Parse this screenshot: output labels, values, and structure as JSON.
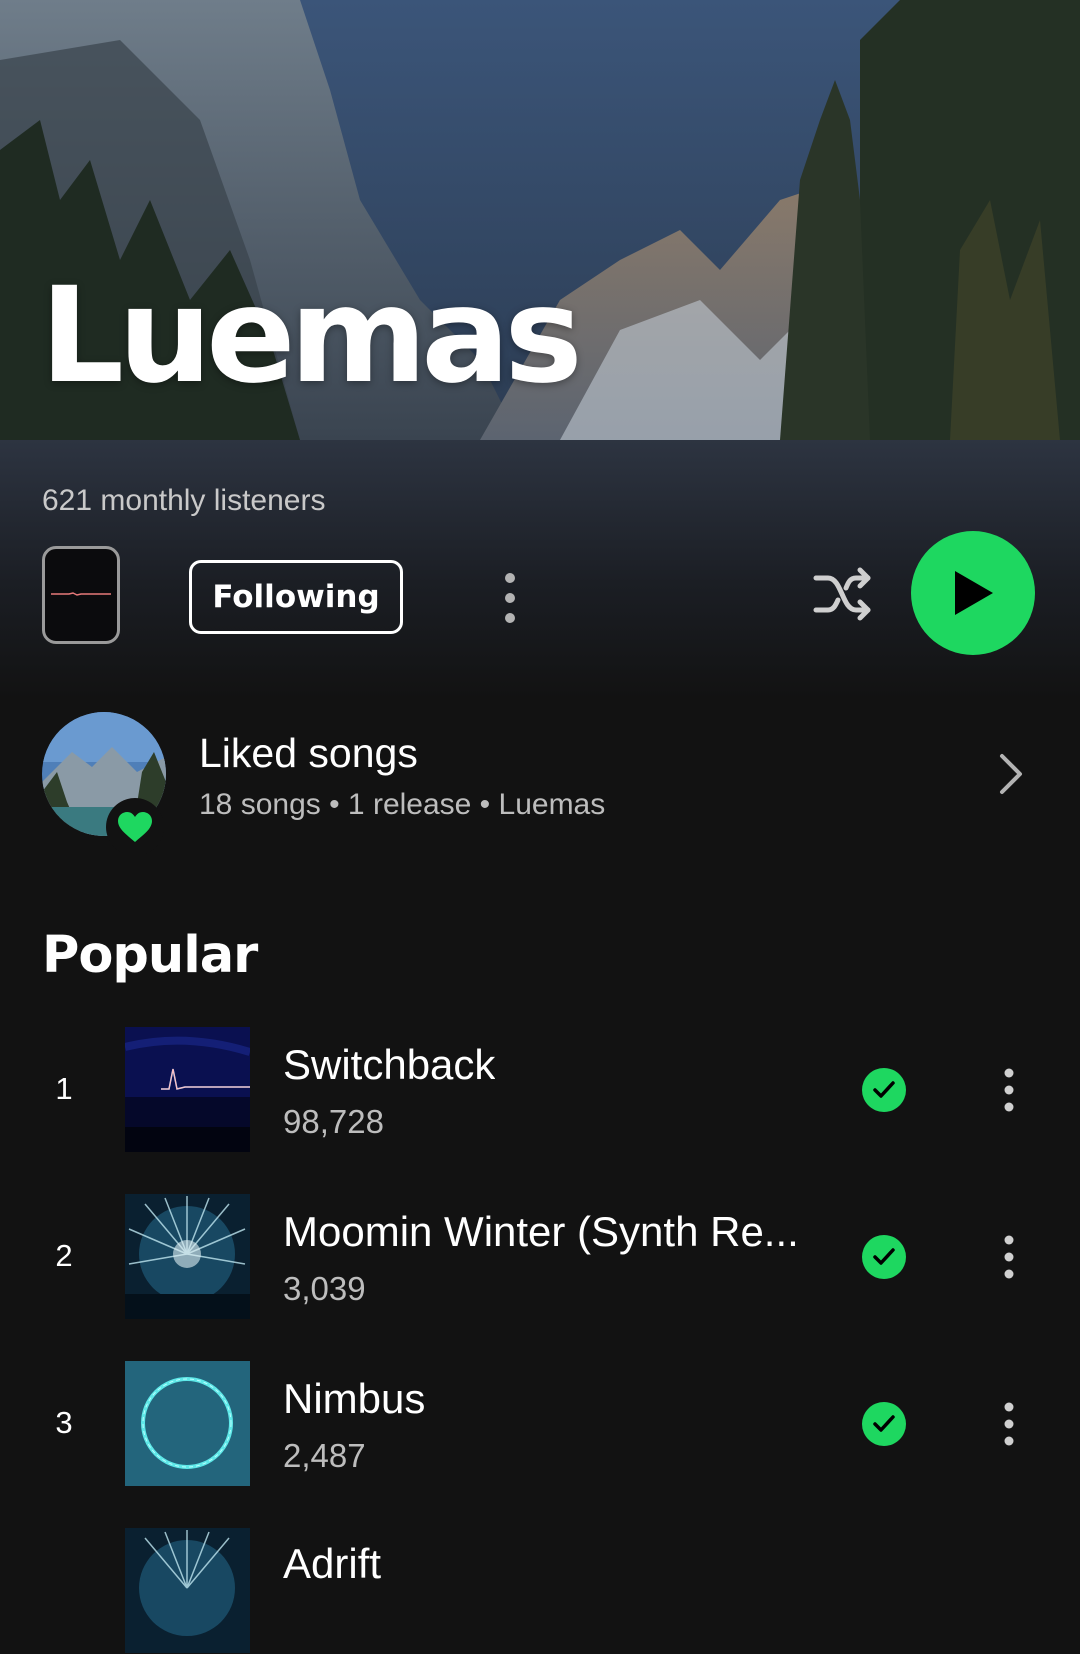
{
  "artist": {
    "name": "Luemas",
    "monthly_listeners": "621 monthly listeners"
  },
  "controls": {
    "follow_label": "Following"
  },
  "liked": {
    "title": "Liked songs",
    "subtitle": "18 songs • 1 release • Luemas"
  },
  "popular": {
    "title": "Popular",
    "tracks": [
      {
        "rank": "1",
        "title": "Switchback",
        "plays": "98,728",
        "downloaded": true
      },
      {
        "rank": "2",
        "title": "Moomin Winter (Synth Re...",
        "plays": "3,039",
        "downloaded": true
      },
      {
        "rank": "3",
        "title": "Nimbus",
        "plays": "2,487",
        "downloaded": true
      },
      {
        "rank": "",
        "title": "Adrift",
        "plays": "",
        "downloaded": false
      }
    ]
  },
  "colors": {
    "accent": "#1ed760",
    "background": "#121212"
  }
}
